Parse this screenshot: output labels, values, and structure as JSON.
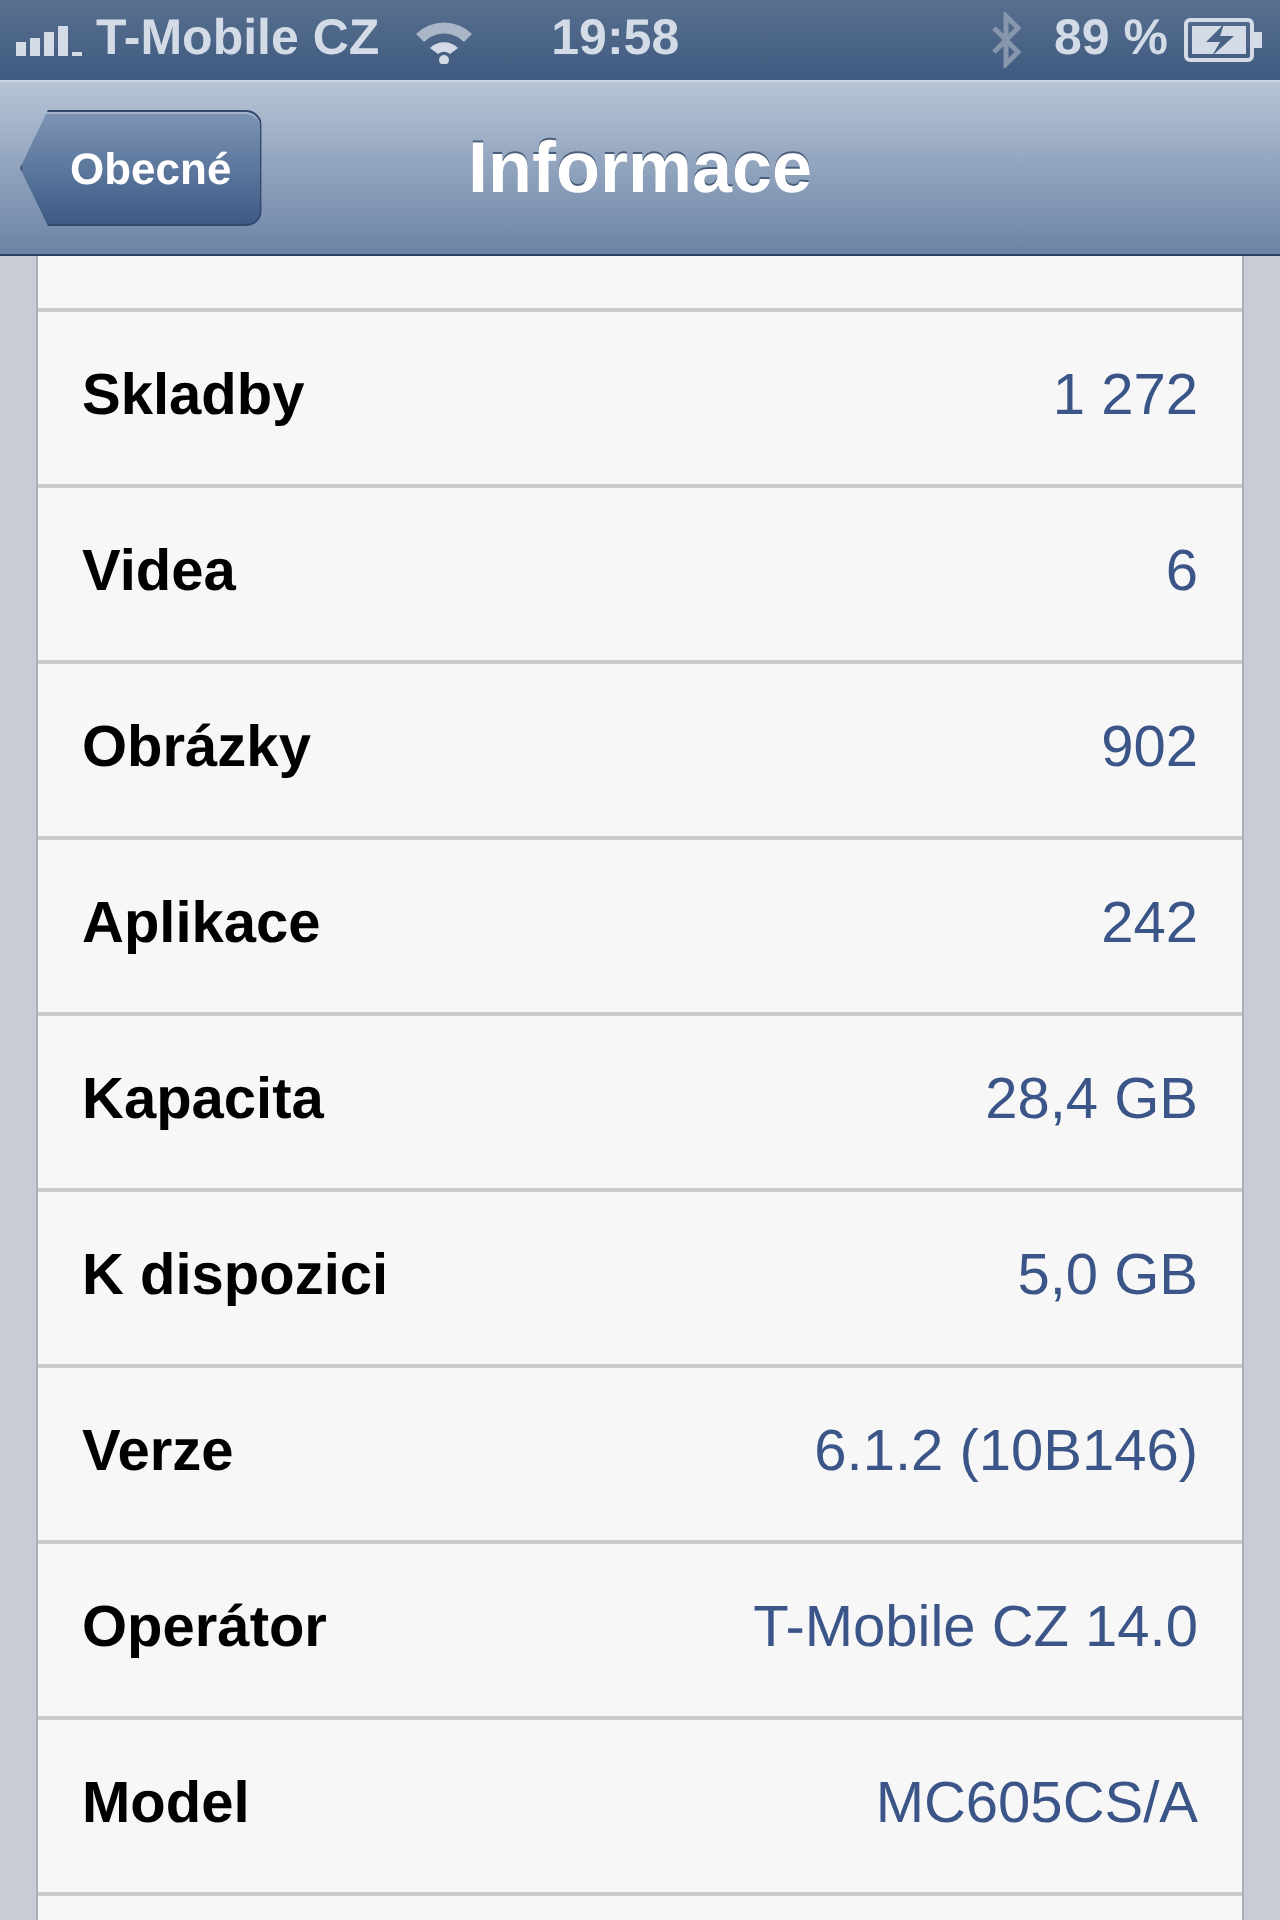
{
  "status_bar": {
    "carrier": "T-Mobile CZ",
    "time": "19:58",
    "battery": "89 %"
  },
  "nav_bar": {
    "back": "Obecné",
    "title": "Informace"
  },
  "rows": [
    {
      "label": "Skladby",
      "value": "1 272"
    },
    {
      "label": "Videa",
      "value": "6"
    },
    {
      "label": "Obrázky",
      "value": "902"
    },
    {
      "label": "Aplikace",
      "value": "242"
    },
    {
      "label": "Kapacita",
      "value": "28,4 GB"
    },
    {
      "label": "K dispozici",
      "value": "5,0 GB"
    },
    {
      "label": "Verze",
      "value": "6.1.2 (10B146)"
    },
    {
      "label": "Operátor",
      "value": "T-Mobile CZ 14.0"
    },
    {
      "label": "Model",
      "value": "MC605CS/A"
    }
  ]
}
